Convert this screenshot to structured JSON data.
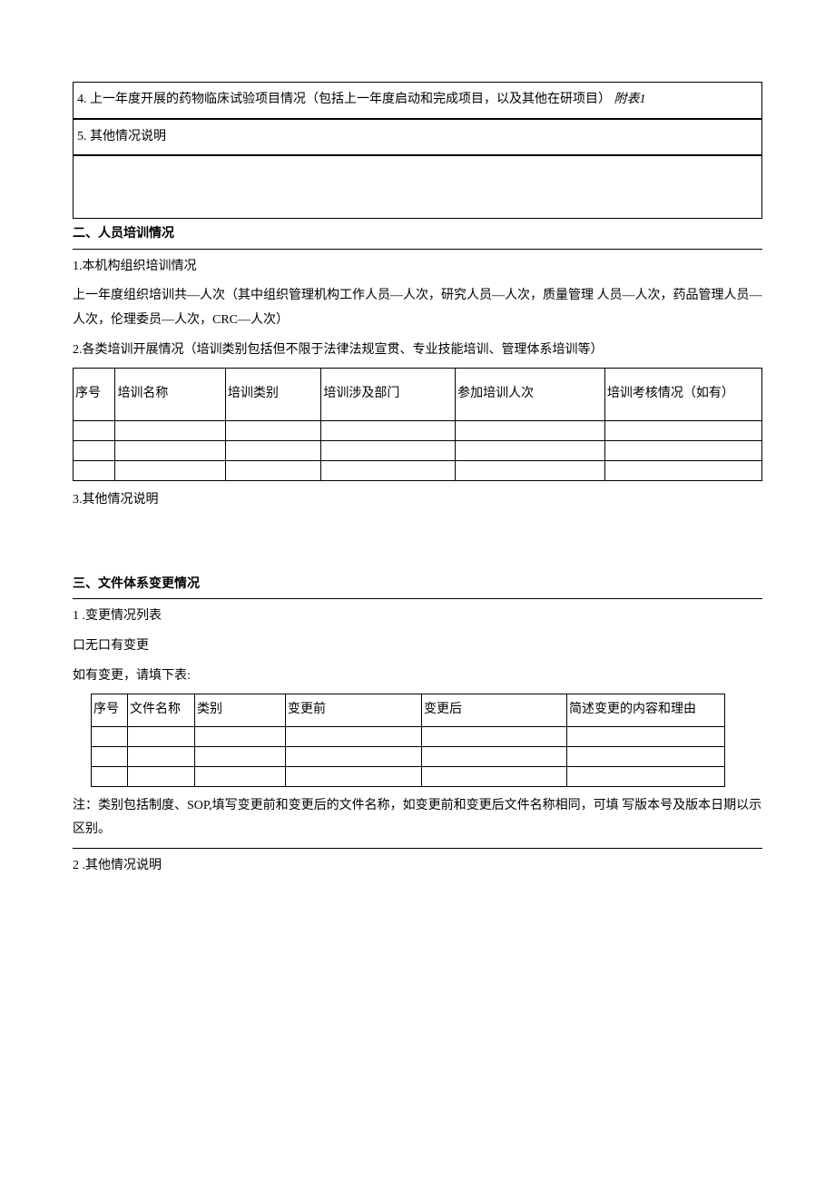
{
  "sec1": {
    "item4_pre": "4.",
    "item4_text": "上一年度开展的药物临床试验项目情况（包括上一年度启动和完成项目，以及其他在研项目）",
    "item4_attach": " 附表1",
    "item5_pre": "5.",
    "item5_text": "其他情况说明"
  },
  "sec2": {
    "title": "二、人员培训情况",
    "p1a": "1.本机构组织培训情况",
    "p1b": "上一年度组织培训共—人次（其中组织管理机构工作人员—人次，研究人员—人次，质量管理 人员—人次，药品管理人员—人次，伦理委员—人次，CRC—人次）",
    "p2": "2.各类培训开展情况（培训类别包括但不限于法律法规宣贯、专业技能培训、管理体系培训等）",
    "th": [
      "序号",
      "培训名称",
      "培训类别",
      "培训涉及部门",
      "参加培训人次",
      "培训考核情况（如有）"
    ],
    "p3": "3.其他情况说明"
  },
  "sec3": {
    "title": "三、文件体系变更情况",
    "p1": "1 .变更情况列表",
    "p1a": "口无口有变更",
    "p1b": "如有变更，请填下表:",
    "th": [
      "序号",
      "文件名称",
      "类别",
      "变更前",
      "变更后",
      "简述变更的内容和理由"
    ],
    "note": "注：类别包括制度、SOP,填写变更前和变更后的文件名称，如变更前和变更后文件名称相同，可填 写版本号及版本日期以示区别。",
    "p2": "2 .其他情况说明"
  }
}
